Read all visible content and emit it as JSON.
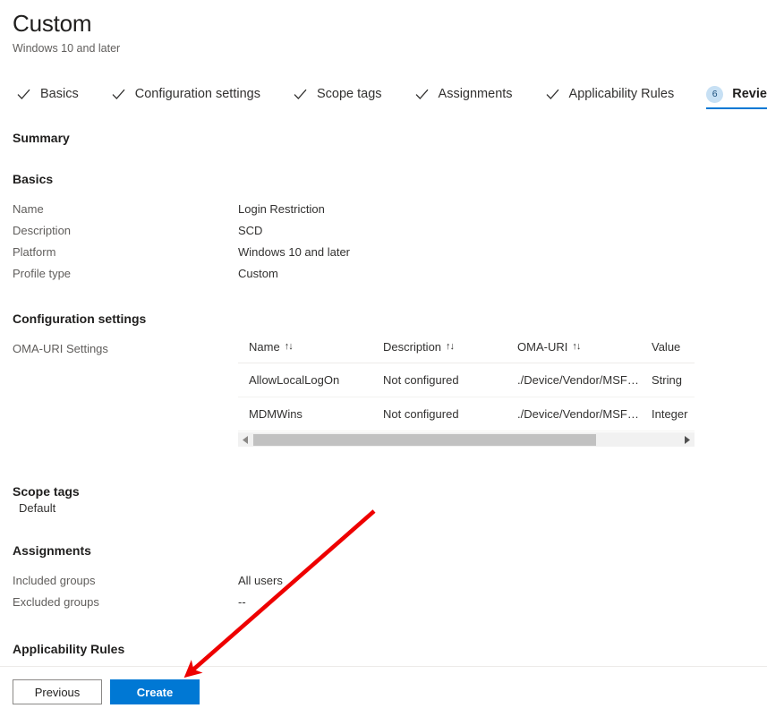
{
  "header": {
    "title": "Custom",
    "subtitle": "Windows 10 and later"
  },
  "wizard": {
    "tabs": [
      {
        "label": "Basics",
        "state": "complete",
        "icon": "check-icon"
      },
      {
        "label": "Configuration settings",
        "state": "complete",
        "icon": "check-icon"
      },
      {
        "label": "Scope tags",
        "state": "complete",
        "icon": "check-icon"
      },
      {
        "label": "Assignments",
        "state": "complete",
        "icon": "check-icon"
      },
      {
        "label": "Applicability Rules",
        "state": "complete",
        "icon": "check-icon"
      },
      {
        "label": "Review + create",
        "state": "active",
        "badge": "6"
      }
    ]
  },
  "summary": {
    "heading": "Summary",
    "basics": {
      "heading": "Basics",
      "rows": [
        {
          "key": "Name",
          "value": "Login Restriction"
        },
        {
          "key": "Description",
          "value": "SCD"
        },
        {
          "key": "Platform",
          "value": "Windows 10 and later"
        },
        {
          "key": "Profile type",
          "value": "Custom"
        }
      ]
    },
    "configuration_settings": {
      "heading": "Configuration settings",
      "label": "OMA-URI Settings",
      "table": {
        "columns": [
          {
            "header": "Name",
            "sortable": true
          },
          {
            "header": "Description",
            "sortable": true
          },
          {
            "header": "OMA-URI",
            "sortable": true
          },
          {
            "header": "Value",
            "sortable": false
          }
        ],
        "sort_glyph": "↑↓",
        "rows": [
          {
            "name": "AllowLocalLogOn",
            "description": "Not configured",
            "oma_uri": "./Device/Vendor/MSFT...",
            "value": "String"
          },
          {
            "name": "MDMWins",
            "description": "Not configured",
            "oma_uri": "./Device/Vendor/MSFT...",
            "value": "Integer"
          }
        ]
      }
    },
    "scope_tags": {
      "heading": "Scope tags",
      "value": "Default"
    },
    "assignments": {
      "heading": "Assignments",
      "rows": [
        {
          "key": "Included groups",
          "value": "All users"
        },
        {
          "key": "Excluded groups",
          "value": "--"
        }
      ]
    },
    "applicability_rules": {
      "heading": "Applicability Rules"
    }
  },
  "footer": {
    "previous_label": "Previous",
    "create_label": "Create"
  },
  "annotation": {
    "color": "#ee0000",
    "points_to": "create-button"
  },
  "colors": {
    "accent": "#0078d4",
    "badge_bg": "#c7e0f4",
    "badge_text": "#1c4f7c",
    "muted_text": "#605e5c",
    "primary_text": "#201f1e",
    "annotation_red": "#ee0000"
  }
}
